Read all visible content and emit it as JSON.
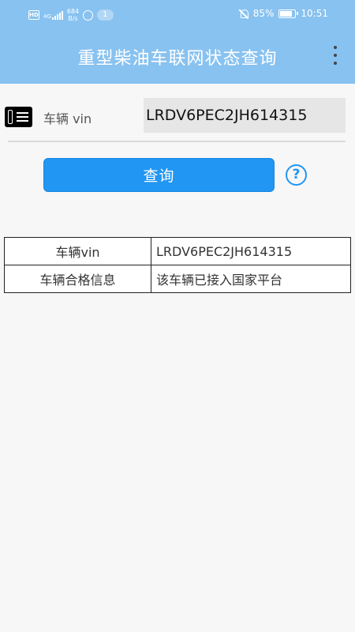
{
  "status_bar": {
    "hd": "HD",
    "network": "4G",
    "speed_value": "684",
    "speed_unit": "B/s",
    "notif_count": "1",
    "battery_text": "85%",
    "battery_level": 0.85,
    "time": "10:51"
  },
  "app_bar": {
    "title": "重型柴油车联网状态查询",
    "menu_icon": "more-vert-icon",
    "color": "#88c2f0"
  },
  "vin_row": {
    "icon": "card-icon",
    "label": "车辆 vin",
    "value": "LRDV6PEC2JH614315"
  },
  "query_button": {
    "label": "查询",
    "color": "#2196f3"
  },
  "help_icon": {
    "glyph": "?"
  },
  "result_table": {
    "rows": [
      {
        "key": "车辆vin",
        "value": "LRDV6PEC2JH614315"
      },
      {
        "key": "车辆合格信息",
        "value": "该车辆已接入国家平台"
      }
    ]
  }
}
